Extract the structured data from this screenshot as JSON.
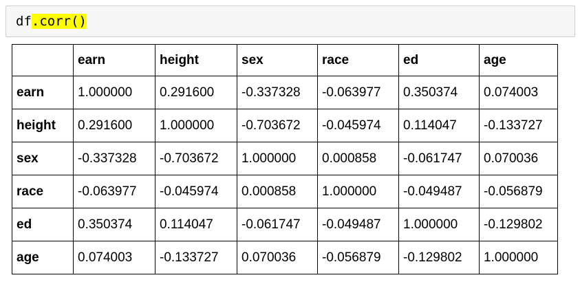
{
  "code": {
    "prefix": "df",
    "highlighted": ".corr()"
  },
  "table": {
    "columns": [
      "",
      "earn",
      "height",
      "sex",
      "race",
      "ed",
      "age"
    ],
    "rows": [
      {
        "label": "earn",
        "values": [
          "1.000000",
          "0.291600",
          "-0.337328",
          "-0.063977",
          "0.350374",
          "0.074003"
        ]
      },
      {
        "label": "height",
        "values": [
          "0.291600",
          "1.000000",
          "-0.703672",
          "-0.045974",
          "0.114047",
          "-0.133727"
        ]
      },
      {
        "label": "sex",
        "values": [
          "-0.337328",
          "-0.703672",
          "1.000000",
          "0.000858",
          "-0.061747",
          "0.070036"
        ]
      },
      {
        "label": "race",
        "values": [
          "-0.063977",
          "-0.045974",
          "0.000858",
          "1.000000",
          "-0.049487",
          "-0.056879"
        ]
      },
      {
        "label": "ed",
        "values": [
          "0.350374",
          "0.114047",
          "-0.061747",
          "-0.049487",
          "1.000000",
          "-0.129802"
        ]
      },
      {
        "label": "age",
        "values": [
          "0.074003",
          "-0.133727",
          "0.070036",
          "-0.056879",
          "-0.129802",
          "1.000000"
        ]
      }
    ]
  },
  "colors": {
    "highlight": "#ffff00",
    "code_background": "#f7f7f7",
    "code_border": "#cfcfcf"
  }
}
